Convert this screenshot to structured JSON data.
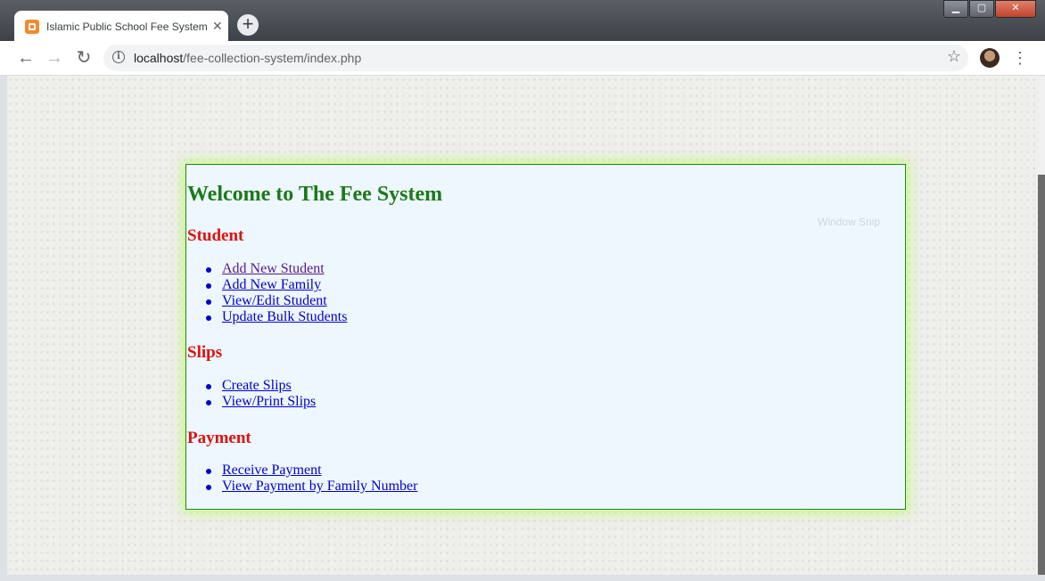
{
  "browser": {
    "tab_title": "Islamic Public School Fee System",
    "tab_close": "✕",
    "new_tab": "+",
    "url_host": "localhost",
    "url_path": "/fee-collection-system/index.php",
    "nav_back": "←",
    "nav_forward": "→",
    "nav_reload": "↻",
    "star": "☆",
    "menu": "⋮",
    "win_min": "▁",
    "win_max": "▢",
    "win_close": "✕"
  },
  "page": {
    "title": "Welcome to The Fee System",
    "ghost_text": "Window Snip",
    "sections": [
      {
        "heading": "Student",
        "links": [
          "Add New Student",
          "Add New Family",
          "View/Edit Student",
          "Update Bulk Students"
        ]
      },
      {
        "heading": "Slips",
        "links": [
          "Create Slips",
          "View/Print Slips"
        ]
      },
      {
        "heading": "Payment",
        "links": [
          "Receive Payment",
          "View Payment by Family Number"
        ]
      }
    ]
  },
  "colors": {
    "title": "#1a7a1a",
    "heading": "#dd1111",
    "link": "#0000cc",
    "visited_link": "#551a8b",
    "panel_bg": "#eef7fd",
    "panel_border": "#1a8a1a"
  },
  "icons": {
    "favicon": "xampp-icon",
    "info": "info-icon",
    "star": "star-icon",
    "menu": "kebab-menu-icon"
  }
}
